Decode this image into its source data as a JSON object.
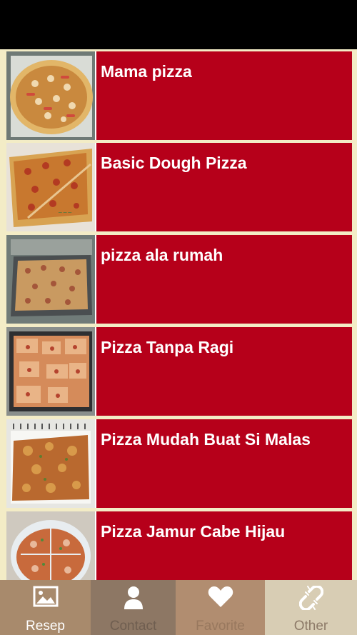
{
  "recipes": [
    {
      "title": "Mama pizza"
    },
    {
      "title": "Basic Dough Pizza"
    },
    {
      "title": "pizza ala rumah"
    },
    {
      "title": "Pizza Tanpa Ragi"
    },
    {
      "title": "Pizza Mudah Buat Si Malas"
    },
    {
      "title": "Pizza Jamur Cabe Hijau"
    }
  ],
  "tabs": [
    {
      "label": "Resep",
      "icon": "image-icon",
      "selected": true
    },
    {
      "label": "Contact",
      "icon": "person-icon",
      "selected": false
    },
    {
      "label": "Favorite",
      "icon": "heart-icon",
      "selected": false
    },
    {
      "label": "Other",
      "icon": "broken-link-icon",
      "selected": false
    }
  ],
  "colors": {
    "card": "#b6001a",
    "background": "#f3ecc6",
    "status_bar": "#000000",
    "tab_resep": "#a88a6c",
    "tab_contact": "#8d7764",
    "tab_favorite": "#b18d70",
    "tab_other": "#d8cdb4"
  }
}
